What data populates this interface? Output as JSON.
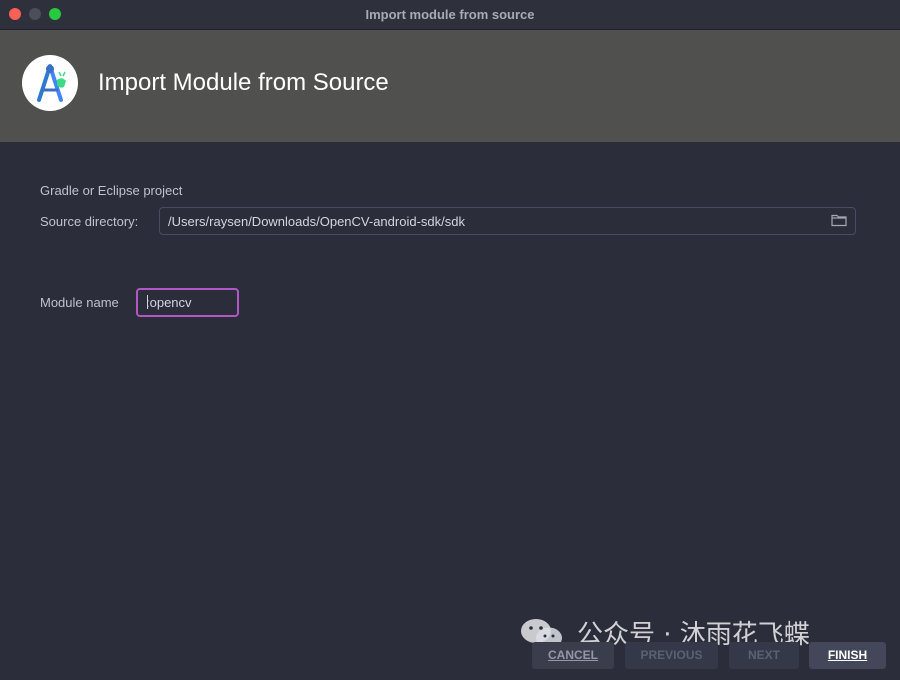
{
  "window": {
    "title": "Import module from source",
    "traffic_lights": {
      "close_color": "#fe5f57",
      "minimize_color": "#4c4e5a",
      "maximize_color": "#28c840"
    }
  },
  "header": {
    "logo_icon": "android-studio-logo-icon",
    "title": "Import Module from Source"
  },
  "form": {
    "section_label": "Gradle or Eclipse project",
    "source_directory": {
      "label": "Source directory:",
      "value": "/Users/raysen/Downloads/OpenCV-android-sdk/sdk",
      "browse_icon": "folder-icon"
    },
    "module_name": {
      "label": "Module name",
      "value": ":opencv"
    }
  },
  "buttons": {
    "cancel": "CANCEL",
    "previous": "PREVIOUS",
    "next": "NEXT",
    "finish": "FINISH"
  },
  "watermark": {
    "icon": "wechat-icon",
    "text": "公众号 · 沐雨花飞蝶"
  },
  "colors": {
    "accent_focus": "#b157c6",
    "header_bg": "#50504f",
    "window_bg": "#2b2d3b"
  }
}
